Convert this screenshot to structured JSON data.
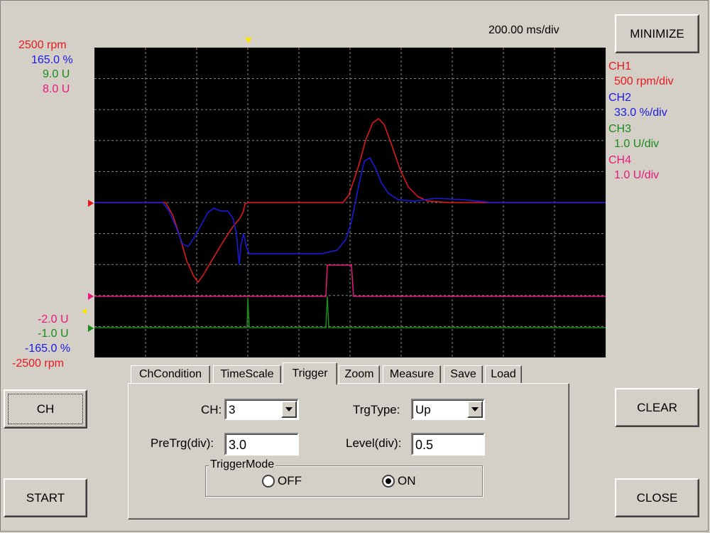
{
  "window": {
    "timescale": "200.00 ms/div"
  },
  "buttons": {
    "minimize": "MINIMIZE",
    "ch": "CH",
    "start": "START",
    "clear": "CLEAR",
    "close": "CLOSE"
  },
  "scale_top": [
    {
      "text": "2500 rpm",
      "color": "#e8191c"
    },
    {
      "text": "165.0 %",
      "color": "#1a1ae6"
    },
    {
      "text": "9.0 U",
      "color": "#1a8a1a"
    },
    {
      "text": "8.0 U",
      "color": "#e8197a"
    }
  ],
  "scale_bottom": [
    {
      "text": "-2.0 U",
      "color": "#e8197a"
    },
    {
      "text": "-1.0 U",
      "color": "#1a8a1a"
    },
    {
      "text": "-165.0 %",
      "color": "#1a1ae6"
    },
    {
      "text": "-2500 rpm",
      "color": "#e8191c"
    }
  ],
  "channels": [
    {
      "name": "CH1",
      "scale": "500 rpm/div",
      "color": "#e8191c"
    },
    {
      "name": "CH2",
      "scale": "33.0 %/div",
      "color": "#1a1ae6"
    },
    {
      "name": "CH3",
      "scale": "1.0 U/div",
      "color": "#1a8a1a"
    },
    {
      "name": "CH4",
      "scale": "1.0 U/div",
      "color": "#e8197a"
    }
  ],
  "tabs": [
    "ChCondition",
    "TimeScale",
    "Trigger",
    "Zoom",
    "Measure",
    "Save",
    "Load"
  ],
  "active_tab": "Trigger",
  "trigger": {
    "ch_label": "CH:",
    "ch_value": "3",
    "trgtype_label": "TrgType:",
    "trgtype_value": "Up",
    "pretrg_label": "PreTrg(div):",
    "pretrg_value": "3.0",
    "level_label": "Level(div):",
    "level_value": "0.5",
    "mode_title": "TriggerMode",
    "mode_off": "OFF",
    "mode_on": "ON",
    "mode_selected": "ON"
  },
  "icons": {
    "trigger_marker": "yellow-down-triangle-icon",
    "dropdown_arrow": "chevron-down-icon"
  }
}
